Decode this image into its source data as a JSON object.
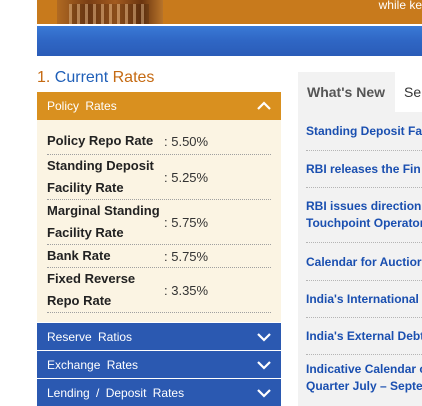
{
  "banner": {
    "tagline": "while ke"
  },
  "section_title": {
    "num": "1.",
    "w1": "Current",
    "w2": "Rates"
  },
  "policy_rates": {
    "header": "Policy  Rates",
    "rows": [
      {
        "name": "Policy Repo Rate",
        "value": ": 5.50%"
      },
      {
        "name": "Standing Deposit Facility Rate",
        "value": ": 5.25%"
      },
      {
        "name": "Marginal Standing Facility Rate",
        "value": ": 5.75%"
      },
      {
        "name": "Bank Rate",
        "value": ": 5.75%"
      },
      {
        "name": "Fixed Reverse Repo Rate",
        "value": ": 3.35%"
      }
    ]
  },
  "collapsed_sections": [
    {
      "label": "Reserve  Ratios"
    },
    {
      "label": "Exchange  Rates"
    },
    {
      "label": "Lending / Deposit  Rates"
    }
  ],
  "tabs": [
    {
      "label": "What's New"
    },
    {
      "label": "Se"
    }
  ],
  "news": [
    {
      "line1": "Standing Deposit Fa"
    },
    {
      "line1": "RBI releases the Fin"
    },
    {
      "line1": "RBI issues direction",
      "line2": "Touchpoint Operator"
    },
    {
      "line1": "Calendar for Auctior"
    },
    {
      "line1": "India's International"
    },
    {
      "line1": "India's External Debt"
    },
    {
      "line1": "Indicative Calendar o",
      "line2": "Quarter July – Septe"
    }
  ],
  "colors": {
    "orange": "#d9901f",
    "blue": "#2b59b1",
    "link": "#1a4fb0"
  }
}
